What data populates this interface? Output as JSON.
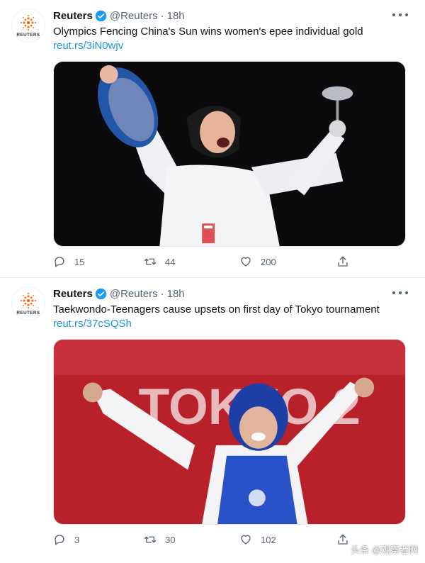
{
  "colors": {
    "link": "#1b95e0",
    "verified": "#1d9bf0",
    "secondary_text": "#536471",
    "reuters_orange": "#fa6400"
  },
  "avatar_text": "REUTERS",
  "tweets": [
    {
      "name": "Reuters",
      "handle": "@Reuters",
      "separator": "·",
      "time": "18h",
      "text": "Olympics Fencing China's Sun wins women's epee individual gold",
      "link": "reut.rs/3iN0wjv",
      "replies": "15",
      "retweets": "44",
      "likes": "200"
    },
    {
      "name": "Reuters",
      "handle": "@Reuters",
      "separator": "·",
      "time": "18h",
      "text": "Taekwondo-Teenagers cause upsets on first day of Tokyo tournament",
      "link": "reut.rs/37cSQSh",
      "replies": "3",
      "retweets": "30",
      "likes": "102",
      "photo_backdrop_text": "TOKYO 2"
    }
  ],
  "watermark": "头条 @观察者网"
}
